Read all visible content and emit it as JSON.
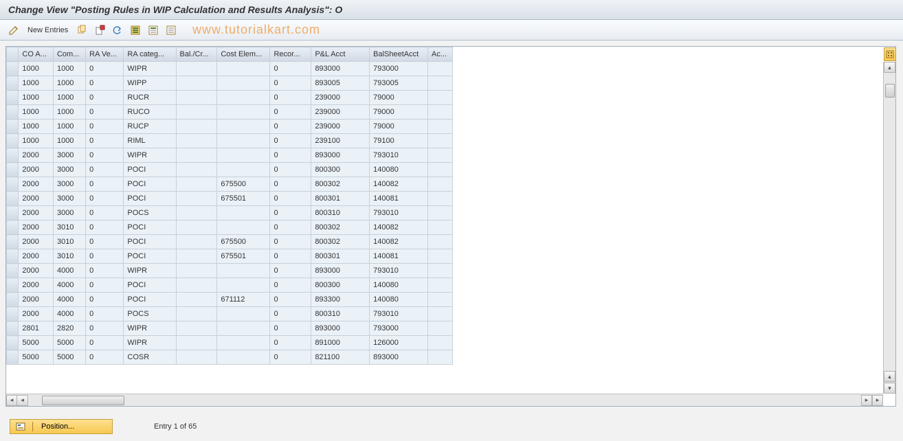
{
  "title": "Change View \"Posting Rules in WIP Calculation and Results Analysis\": O",
  "toolbar": {
    "new_entries": "New Entries"
  },
  "watermark": "www.tutorialkart.com",
  "columns": {
    "coa": "CO A...",
    "com": "Com...",
    "rav": "RA Ve...",
    "racat": "RA categ...",
    "bal": "Bal./Cr...",
    "cost": "Cost Elem...",
    "rec": "Recor...",
    "pl": "P&L Acct",
    "bs": "BalSheetAcct",
    "ac": "Ac..."
  },
  "rows": [
    {
      "coa": "1000",
      "com": "1000",
      "rav": "0",
      "racat": "WIPR",
      "bal": "",
      "cost": "",
      "rec": "0",
      "pl": "893000",
      "bs": "793000",
      "ac": ""
    },
    {
      "coa": "1000",
      "com": "1000",
      "rav": "0",
      "racat": "WIPP",
      "bal": "",
      "cost": "",
      "rec": "0",
      "pl": "893005",
      "bs": "793005",
      "ac": ""
    },
    {
      "coa": "1000",
      "com": "1000",
      "rav": "0",
      "racat": "RUCR",
      "bal": "",
      "cost": "",
      "rec": "0",
      "pl": "239000",
      "bs": "79000",
      "ac": ""
    },
    {
      "coa": "1000",
      "com": "1000",
      "rav": "0",
      "racat": "RUCO",
      "bal": "",
      "cost": "",
      "rec": "0",
      "pl": "239000",
      "bs": "79000",
      "ac": ""
    },
    {
      "coa": "1000",
      "com": "1000",
      "rav": "0",
      "racat": "RUCP",
      "bal": "",
      "cost": "",
      "rec": "0",
      "pl": "239000",
      "bs": "79000",
      "ac": ""
    },
    {
      "coa": "1000",
      "com": "1000",
      "rav": "0",
      "racat": "RIML",
      "bal": "",
      "cost": "",
      "rec": "0",
      "pl": "239100",
      "bs": "79100",
      "ac": ""
    },
    {
      "coa": "2000",
      "com": "3000",
      "rav": "0",
      "racat": "WIPR",
      "bal": "",
      "cost": "",
      "rec": "0",
      "pl": "893000",
      "bs": "793010",
      "ac": ""
    },
    {
      "coa": "2000",
      "com": "3000",
      "rav": "0",
      "racat": "POCI",
      "bal": "",
      "cost": "",
      "rec": "0",
      "pl": "800300",
      "bs": "140080",
      "ac": ""
    },
    {
      "coa": "2000",
      "com": "3000",
      "rav": "0",
      "racat": "POCI",
      "bal": "",
      "cost": "675500",
      "rec": "0",
      "pl": "800302",
      "bs": "140082",
      "ac": ""
    },
    {
      "coa": "2000",
      "com": "3000",
      "rav": "0",
      "racat": "POCI",
      "bal": "",
      "cost": "675501",
      "rec": "0",
      "pl": "800301",
      "bs": "140081",
      "ac": ""
    },
    {
      "coa": "2000",
      "com": "3000",
      "rav": "0",
      "racat": "POCS",
      "bal": "",
      "cost": "",
      "rec": "0",
      "pl": "800310",
      "bs": "793010",
      "ac": ""
    },
    {
      "coa": "2000",
      "com": "3010",
      "rav": "0",
      "racat": "POCI",
      "bal": "",
      "cost": "",
      "rec": "0",
      "pl": "800302",
      "bs": "140082",
      "ac": ""
    },
    {
      "coa": "2000",
      "com": "3010",
      "rav": "0",
      "racat": "POCI",
      "bal": "",
      "cost": "675500",
      "rec": "0",
      "pl": "800302",
      "bs": "140082",
      "ac": ""
    },
    {
      "coa": "2000",
      "com": "3010",
      "rav": "0",
      "racat": "POCI",
      "bal": "",
      "cost": "675501",
      "rec": "0",
      "pl": "800301",
      "bs": "140081",
      "ac": ""
    },
    {
      "coa": "2000",
      "com": "4000",
      "rav": "0",
      "racat": "WIPR",
      "bal": "",
      "cost": "",
      "rec": "0",
      "pl": "893000",
      "bs": "793010",
      "ac": ""
    },
    {
      "coa": "2000",
      "com": "4000",
      "rav": "0",
      "racat": "POCI",
      "bal": "",
      "cost": "",
      "rec": "0",
      "pl": "800300",
      "bs": "140080",
      "ac": ""
    },
    {
      "coa": "2000",
      "com": "4000",
      "rav": "0",
      "racat": "POCI",
      "bal": "",
      "cost": "671112",
      "rec": "0",
      "pl": "893300",
      "bs": "140080",
      "ac": ""
    },
    {
      "coa": "2000",
      "com": "4000",
      "rav": "0",
      "racat": "POCS",
      "bal": "",
      "cost": "",
      "rec": "0",
      "pl": "800310",
      "bs": "793010",
      "ac": ""
    },
    {
      "coa": "2801",
      "com": "2820",
      "rav": "0",
      "racat": "WIPR",
      "bal": "",
      "cost": "",
      "rec": "0",
      "pl": "893000",
      "bs": "793000",
      "ac": ""
    },
    {
      "coa": "5000",
      "com": "5000",
      "rav": "0",
      "racat": "WIPR",
      "bal": "",
      "cost": "",
      "rec": "0",
      "pl": "891000",
      "bs": "126000",
      "ac": ""
    },
    {
      "coa": "5000",
      "com": "5000",
      "rav": "0",
      "racat": "COSR",
      "bal": "",
      "cost": "",
      "rec": "0",
      "pl": "821100",
      "bs": "893000",
      "ac": ""
    }
  ],
  "footer": {
    "position_label": "Position...",
    "entry_text": "Entry 1 of 65"
  }
}
